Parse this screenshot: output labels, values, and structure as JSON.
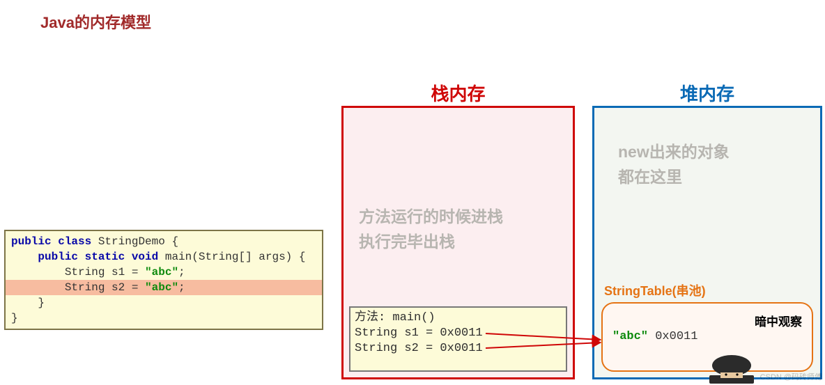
{
  "title": "Java的内存模型",
  "code": {
    "line1_pre": "public class ",
    "line1_cls": "StringDemo",
    "line1_post": " {",
    "line2_pre": "    public static void ",
    "line2_method": "main",
    "line2_post": "(String[] args) {",
    "line3_pre": "        String s1 = ",
    "line3_val": "\"abc\"",
    "line3_end": ";",
    "line4_pre": "        String s2 = ",
    "line4_val": "\"abc\"",
    "line4_end": ";",
    "line5": "    }",
    "line6": "}"
  },
  "stack": {
    "title": "栈内存",
    "note_line1": "方法运行的时候进栈",
    "note_line2": "执行完毕出栈",
    "frame_title": "方法: main()",
    "frame_s1": "String s1 = 0x0011",
    "frame_s2": "String s2 = 0x0011"
  },
  "heap": {
    "title": "堆内存",
    "note_line1": "new出来的对象",
    "note_line2": "都在这里",
    "pool_label": "StringTable(串池)",
    "entry_val": "\"abc\"",
    "entry_addr": " 0x0011",
    "watch_label": "暗中观察"
  },
  "watermark": "CSDN @码砖师傅"
}
